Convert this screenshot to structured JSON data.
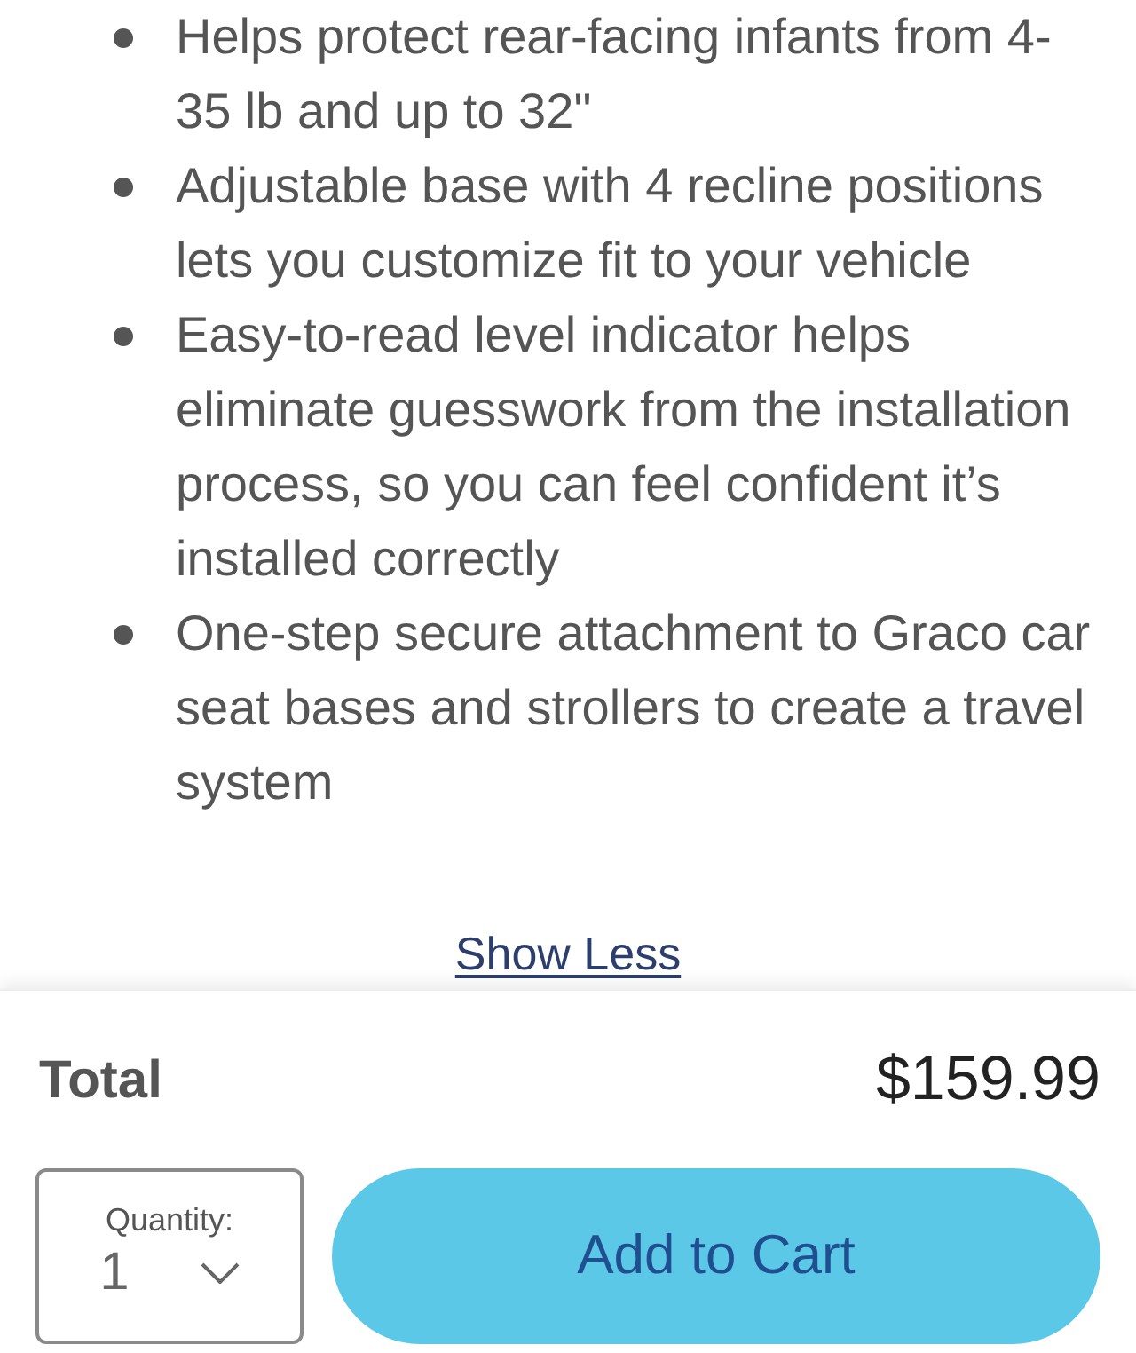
{
  "features": [
    "Helps protect rear-facing infants from 4-35 lb and up to 32\"",
    "Adjustable base with 4 recline positions lets you customize fit to your vehicle",
    "Easy-to-read level indicator helps eliminate guesswork from the installation process, so you can feel confident it’s installed correctly",
    "One-step secure attachment to Graco car seat bases and strollers to create a travel system"
  ],
  "toggle_link": "Show Less",
  "footer": {
    "total_label": "Total",
    "total_price": "$159.99",
    "quantity": {
      "label": "Quantity:",
      "value": "1"
    },
    "add_to_cart": "Add to Cart"
  }
}
